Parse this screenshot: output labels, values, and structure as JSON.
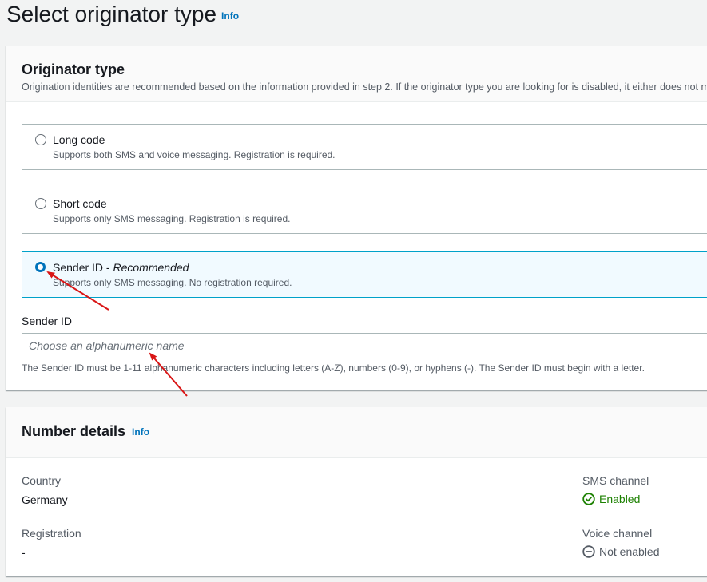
{
  "page": {
    "title": "Select originator type",
    "info": "Info"
  },
  "originator": {
    "heading": "Originator type",
    "description": "Origination identities are recommended based on the information provided in step 2. If the originator type you are looking for is disabled, it either does not m",
    "options": [
      {
        "label": "Long code",
        "suffix": "",
        "description": "Supports both SMS and voice messaging. Registration is required.",
        "selected": false
      },
      {
        "label": "Short code",
        "suffix": "",
        "description": "Supports only SMS messaging. Registration is required.",
        "selected": false
      },
      {
        "label": "Sender ID - ",
        "suffix": "Recommended",
        "description": "Supports only SMS messaging. No registration required.",
        "selected": true
      }
    ],
    "sender_id": {
      "label": "Sender ID",
      "placeholder": "Choose an alphanumeric name",
      "value": "",
      "constraint": "The Sender ID must be 1-11 alphanumeric characters including letters (A-Z), numbers (0-9), or hyphens (-). The Sender ID must begin with a letter."
    }
  },
  "number_details": {
    "heading": "Number details",
    "info": "Info",
    "country_label": "Country",
    "country_value": "Germany",
    "registration_label": "Registration",
    "registration_value": "-",
    "sms_channel_label": "SMS channel",
    "sms_channel_status": "Enabled",
    "voice_channel_label": "Voice channel",
    "voice_channel_status": "Not enabled"
  },
  "colors": {
    "accent": "#0073bb",
    "success": "#1d8102",
    "annotation_arrow": "#d91515"
  },
  "icons": {
    "enabled": "check-circle-icon",
    "disabled": "minus-circle-icon"
  }
}
